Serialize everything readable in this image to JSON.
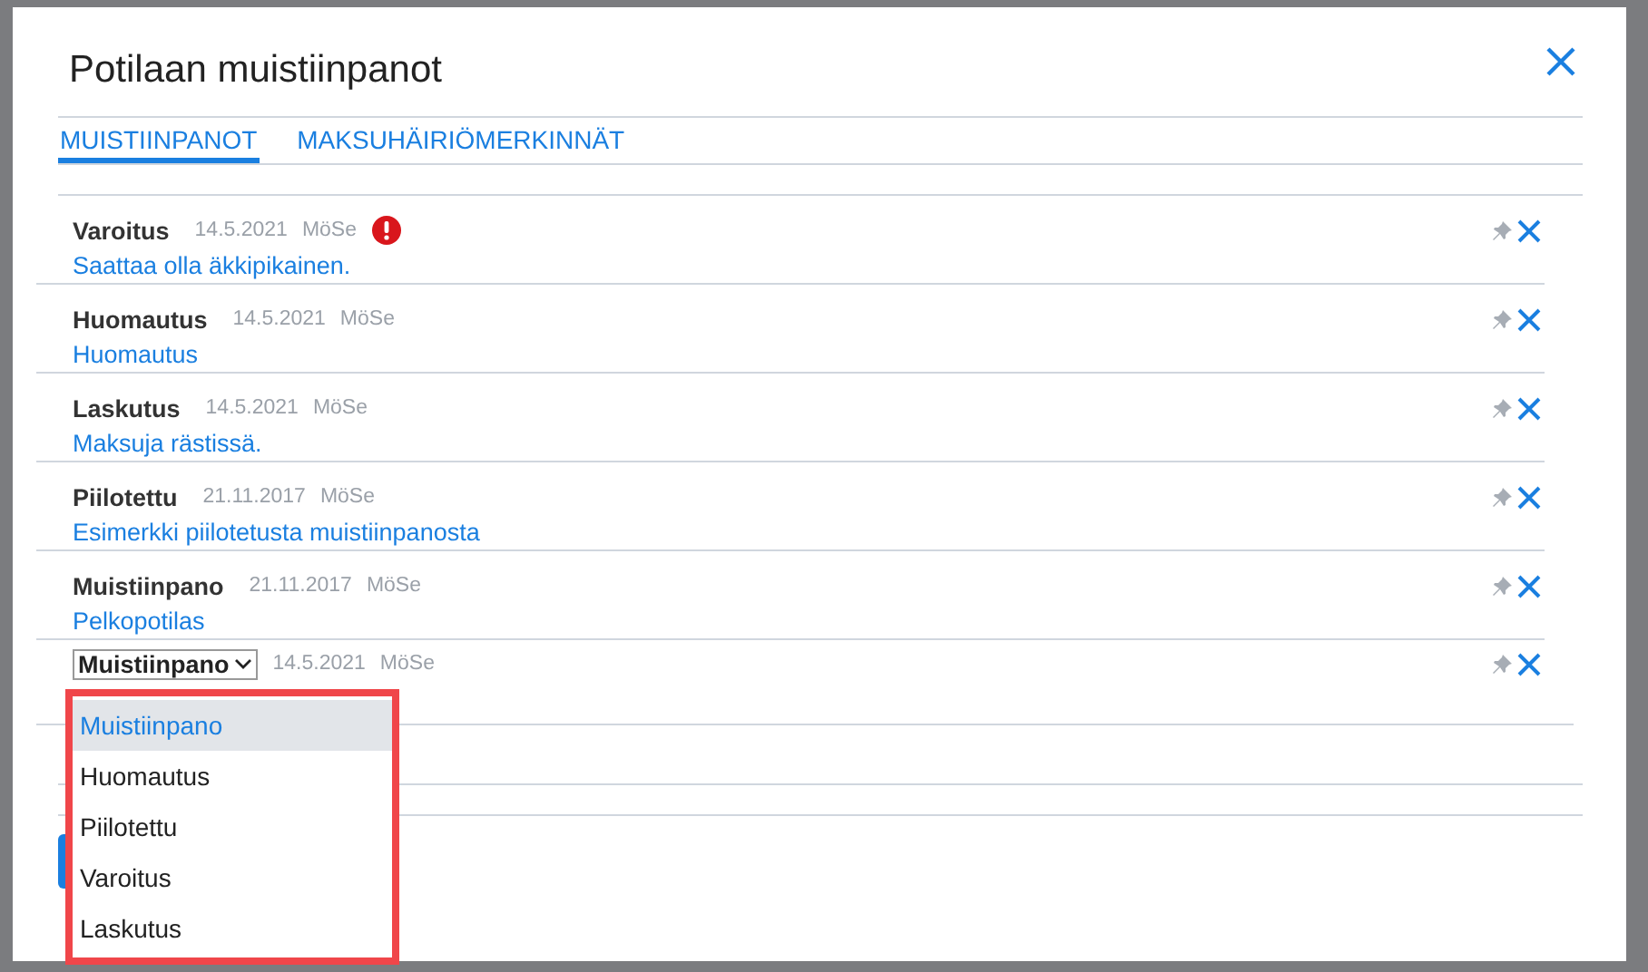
{
  "dialog": {
    "title": "Potilaan muistiinpanot"
  },
  "tabs": [
    {
      "label": "MUISTIINPANOT",
      "selected": true
    },
    {
      "label": "MAKSUHÄIRIÖMERKINNÄT",
      "selected": false
    }
  ],
  "notes": [
    {
      "kind": "view",
      "type": "Varoitus",
      "date": "14.5.2021",
      "author": "MöSe",
      "alert": true,
      "text": "Saattaa olla äkkipikainen."
    },
    {
      "kind": "view",
      "type": "Huomautus",
      "date": "14.5.2021",
      "author": "MöSe",
      "alert": false,
      "text": "Huomautus"
    },
    {
      "kind": "view",
      "type": "Laskutus",
      "date": "14.5.2021",
      "author": "MöSe",
      "alert": false,
      "text": "Maksuja rästissä."
    },
    {
      "kind": "view",
      "type": "Piilotettu",
      "date": "21.11.2017",
      "author": "MöSe",
      "alert": false,
      "text": "Esimerkki piilotetusta muistiinpanosta"
    },
    {
      "kind": "view",
      "type": "Muistiinpano",
      "date": "21.11.2017",
      "author": "MöSe",
      "alert": false,
      "text": "Pelkopotilas"
    },
    {
      "kind": "edit",
      "type": "Muistiinpano",
      "date": "14.5.2021",
      "author": "MöSe",
      "alert": false
    }
  ],
  "type_dropdown": {
    "options": [
      {
        "label": "Muistiinpano",
        "selected": true
      },
      {
        "label": "Huomautus",
        "selected": false
      },
      {
        "label": "Piilotettu",
        "selected": false
      },
      {
        "label": "Varoitus",
        "selected": false
      },
      {
        "label": "Laskutus",
        "selected": false
      }
    ]
  }
}
